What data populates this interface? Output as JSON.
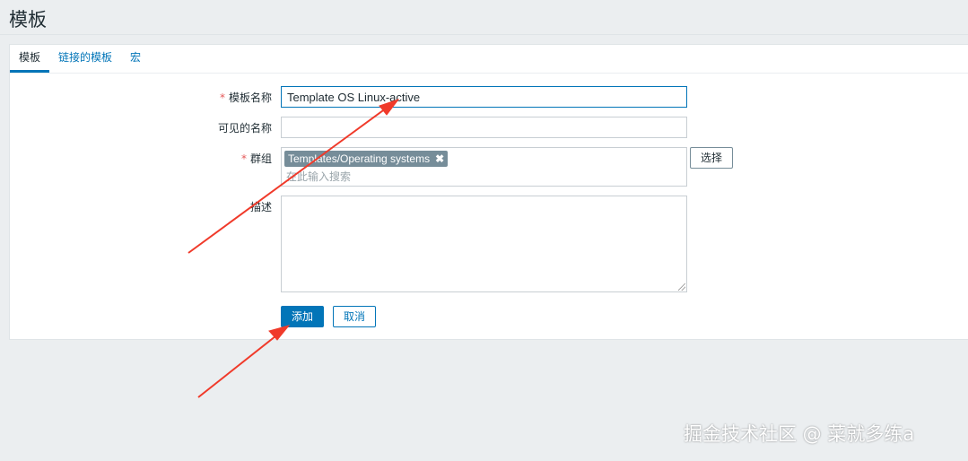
{
  "page": {
    "title": "模板"
  },
  "tabs": [
    {
      "label": "模板",
      "active": true
    },
    {
      "label": "链接的模板",
      "active": false
    },
    {
      "label": "宏",
      "active": false
    }
  ],
  "form": {
    "required_mark": "*",
    "template_name": {
      "label": "模板名称",
      "value": "Template OS Linux-active",
      "required": true
    },
    "visible_name": {
      "label": "可见的名称",
      "value": ""
    },
    "groups": {
      "label": "群组",
      "required": true,
      "selected": [
        "Templates/Operating systems"
      ],
      "chip_remove_glyph": "✖",
      "placeholder": "在此输入搜索",
      "select_button": "选择"
    },
    "description": {
      "label": "描述",
      "value": ""
    },
    "buttons": {
      "add": "添加",
      "cancel": "取消"
    }
  },
  "annotations": {
    "arrow_color": "#f03a2a"
  },
  "watermark": "掘金技术社区 @ 菜就多练a",
  "colors": {
    "accent": "#0275b8",
    "chip": "#768d99",
    "required": "#e45959",
    "background": "#ebeef0"
  }
}
